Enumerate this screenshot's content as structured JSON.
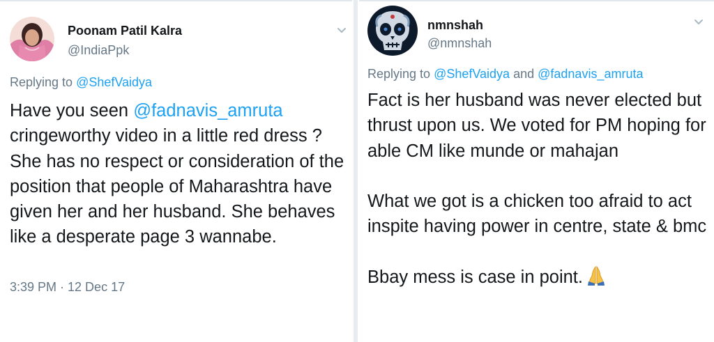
{
  "left_tweet": {
    "author_name": "Poonam Patil Kalra",
    "author_handle": "@IndiaPpk",
    "replying_prefix": "Replying to ",
    "replying_to": "@ShefVaidya",
    "body_before": "Have you seen ",
    "mention": "@fadnavis_amruta",
    "body_after": " cringeworthy video in a little red dress ? She has no respect or consideration of the position that people of Maharashtra have given her and her husband. She behaves like a desperate page 3 wannabe.",
    "timestamp": "3:39 PM · 12 Dec 17"
  },
  "right_tweet": {
    "author_name": "nmnshah",
    "author_handle": "@nmnshah",
    "replying_prefix": "Replying to ",
    "replying_to_1": "@ShefVaidya",
    "replying_joiner": " and ",
    "replying_to_2": "@fadnavis_amruta",
    "paragraph_1": "Fact is her husband was never elected but thrust upon us. We voted for PM hoping for able CM like munde or mahajan",
    "paragraph_2": "What we got is a chicken too afraid to act inspite having power in centre, state & bmc",
    "paragraph_3": "Bbay mess is case in point.",
    "emoji_icon": "folded-hands"
  },
  "colors": {
    "link": "#1da1f2",
    "secondary_text": "#657786",
    "primary_text": "#14171a"
  }
}
